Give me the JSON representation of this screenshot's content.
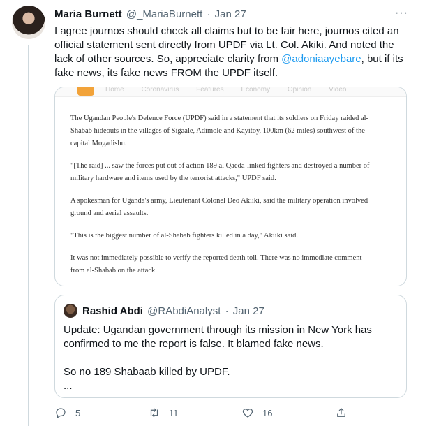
{
  "tweet": {
    "author_name": "Maria Burnett",
    "author_handle": "@_MariaBurnett",
    "separator": "·",
    "date": "Jan 27",
    "text_before": "I agree journos should check all claims but to be fair here, journos cited an official statement sent directly from UPDF via Lt. Col. Akiki. And noted the lack of other sources. So, appreciate clarity from ",
    "mention": "@adoniaayebare",
    "text_after": ", but if its fake news, its fake news FROM the UPDF itself.",
    "more_icon": "more-icon"
  },
  "media": {
    "nav_items": "Home Coronavirus Features Economy Opinion Video",
    "paragraphs": [
      "The Ugandan People's Defence Force (UPDF) said in a statement that its soldiers on Friday raided al-Shabab hideouts in the villages of Sigaale, Adimole and Kayitoy, 100km (62 miles) southwest of the capital Mogadishu.",
      "\"[The raid] ... saw the forces put out of action 189 al Qaeda-linked fighters and destroyed a number of military hardware and items used by the terrorist attacks,\" UPDF said.",
      "A spokesman for Uganda's army, Lieutenant Colonel Deo Akiiki, said the military operation involved ground and aerial assaults.",
      "\"This is the biggest number of al-Shabab fighters killed in a day,\" Akiiki said.",
      "It was not immediately possible to verify the reported death toll. There was no immediate comment from al-Shabab on the attack."
    ]
  },
  "quote": {
    "author_name": "Rashid Abdi",
    "author_handle": "@RAbdiAnalyst",
    "separator": "·",
    "date": "Jan 27",
    "line1": "Update: Ugandan government through its mission in New York has confirmed to me the report is false. It blamed fake news.",
    "line2": "So no 189 Shabaab killed by UPDF.",
    "ellipsis": "..."
  },
  "actions": {
    "reply_count": "5",
    "retweet_count": "11",
    "like_count": "16"
  },
  "colors": {
    "link": "#1d9bf0",
    "secondary_text": "#536471",
    "border": "#cfd9de"
  }
}
